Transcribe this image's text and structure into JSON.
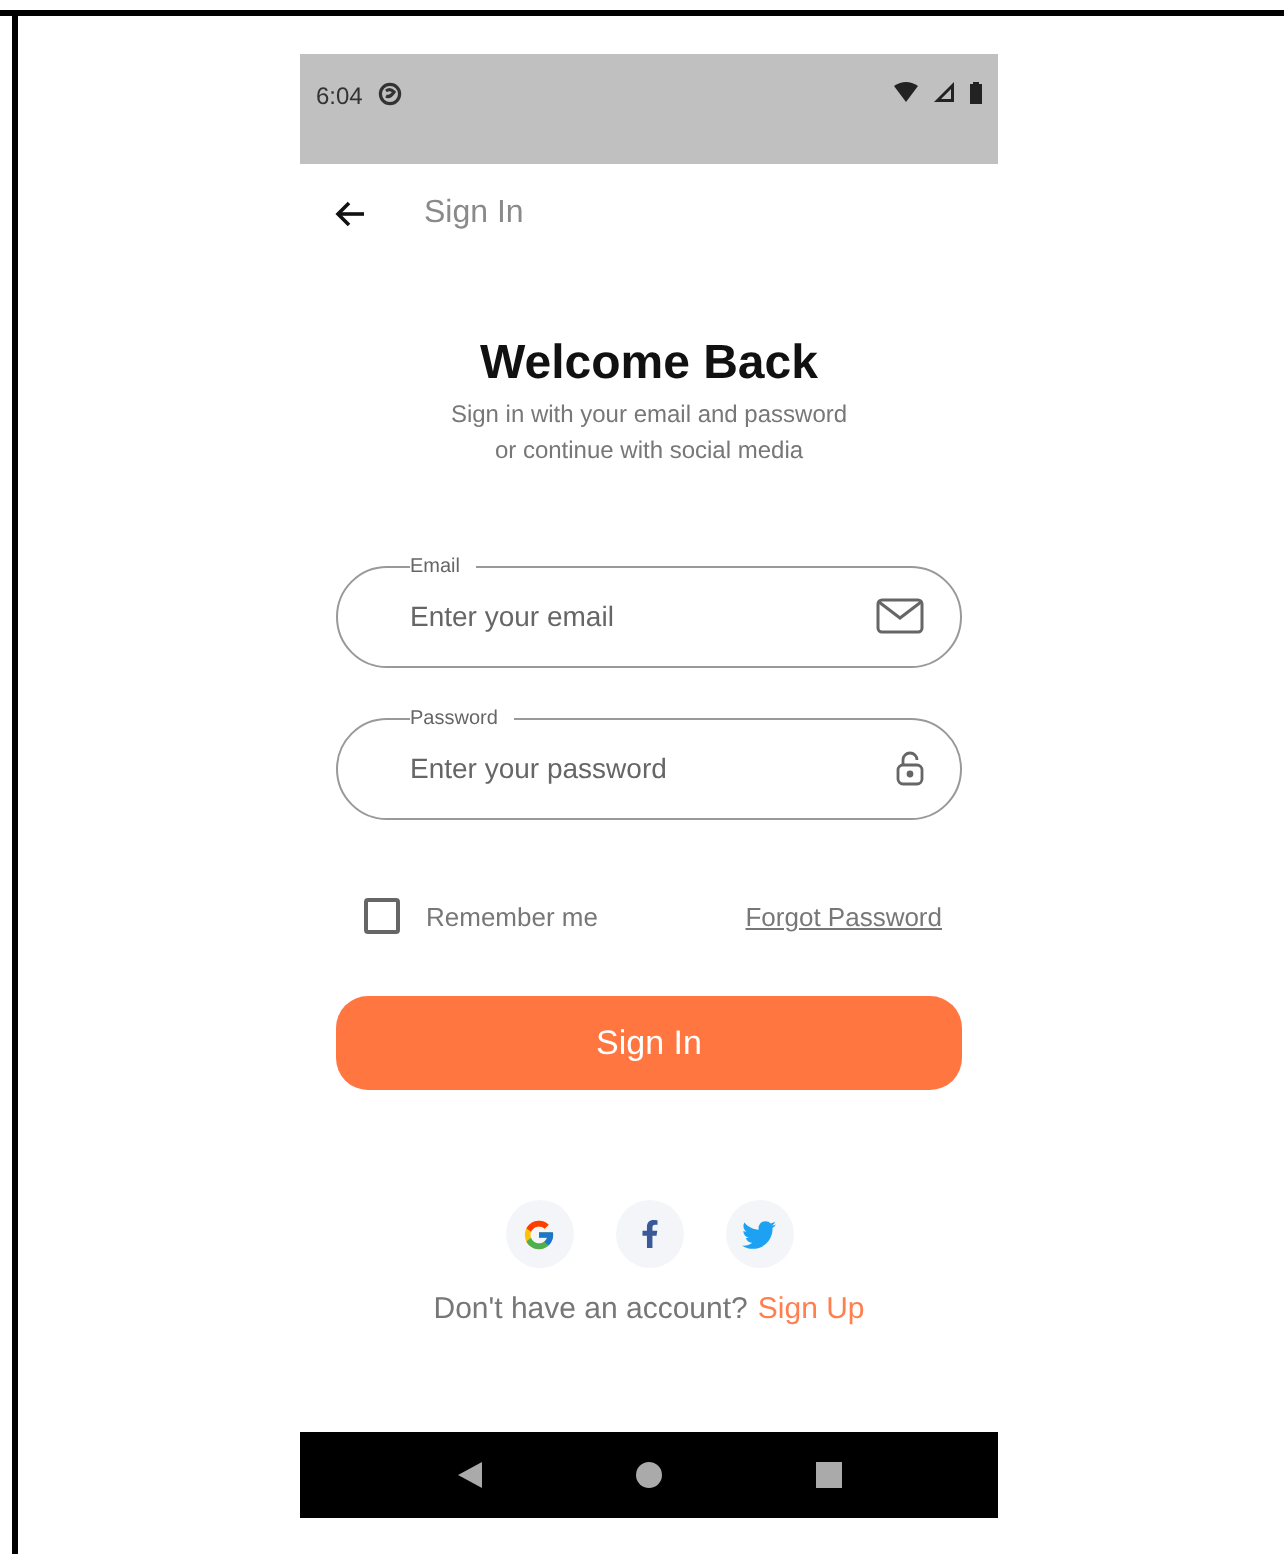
{
  "status_bar": {
    "time": "6:04"
  },
  "header": {
    "title": "Sign In"
  },
  "heading": "Welcome Back",
  "subtitle_lines": [
    "Sign in with your email and password",
    "or continue with social media"
  ],
  "fields": [
    {
      "kind": "email",
      "label": "Email",
      "placeholder": "Enter your email"
    },
    {
      "kind": "password",
      "label": "Password",
      "placeholder": "Enter your password"
    }
  ],
  "remember": {
    "label": "Remember me",
    "checked": false
  },
  "forgot_link": "Forgot Password",
  "submit_button": "Sign In",
  "social": [
    {
      "kind": "google"
    },
    {
      "kind": "facebook"
    },
    {
      "kind": "twitter"
    }
  ],
  "signup": {
    "prompt": "Don't have an account?",
    "link": "Sign Up"
  }
}
